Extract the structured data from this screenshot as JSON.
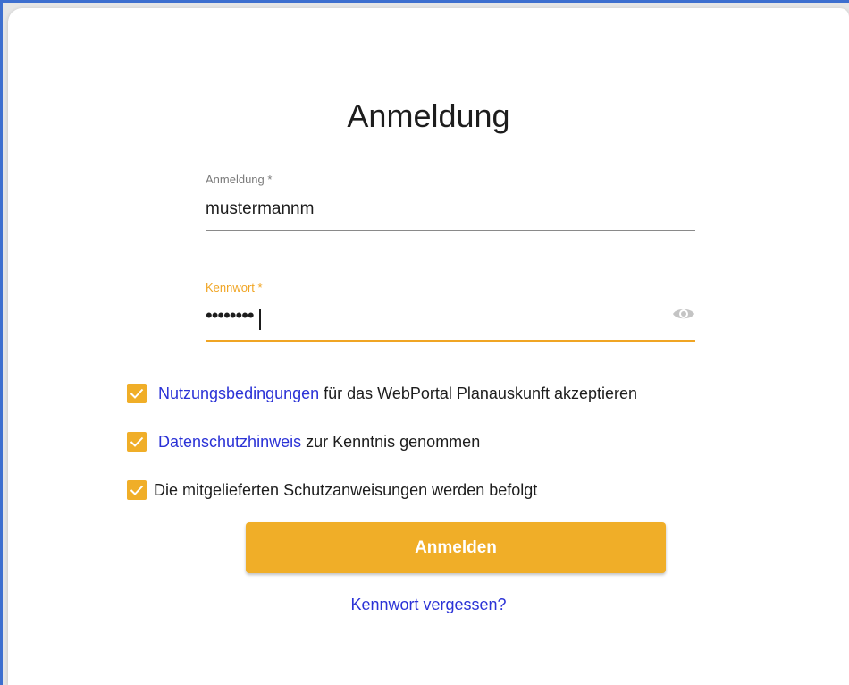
{
  "login": {
    "title": "Anmeldung",
    "username": {
      "label": "Anmeldung *",
      "value": "mustermannm"
    },
    "password": {
      "label": "Kennwort *",
      "value": "••••••••"
    },
    "checkboxes": [
      {
        "checked": true,
        "link": "Nutzungsbedingungen",
        "text": "für das WebPortal Planauskunft akzeptieren"
      },
      {
        "checked": true,
        "link": "Datenschutzhinweis",
        "text": "zur Kenntnis genommen"
      },
      {
        "checked": true,
        "text": "Die mitgelieferten Schutzanweisungen werden befolgt"
      }
    ],
    "submit_label": "Anmelden",
    "forgot_label": "Kennwort vergessen?"
  },
  "icons": {
    "password_toggle": "eye-icon",
    "checkbox_mark": "checkmark-icon"
  },
  "colors": {
    "accent": "#f0ae28",
    "link": "#2b32d6",
    "frame": "#3d6fcf",
    "text": "#1d1d1d"
  }
}
